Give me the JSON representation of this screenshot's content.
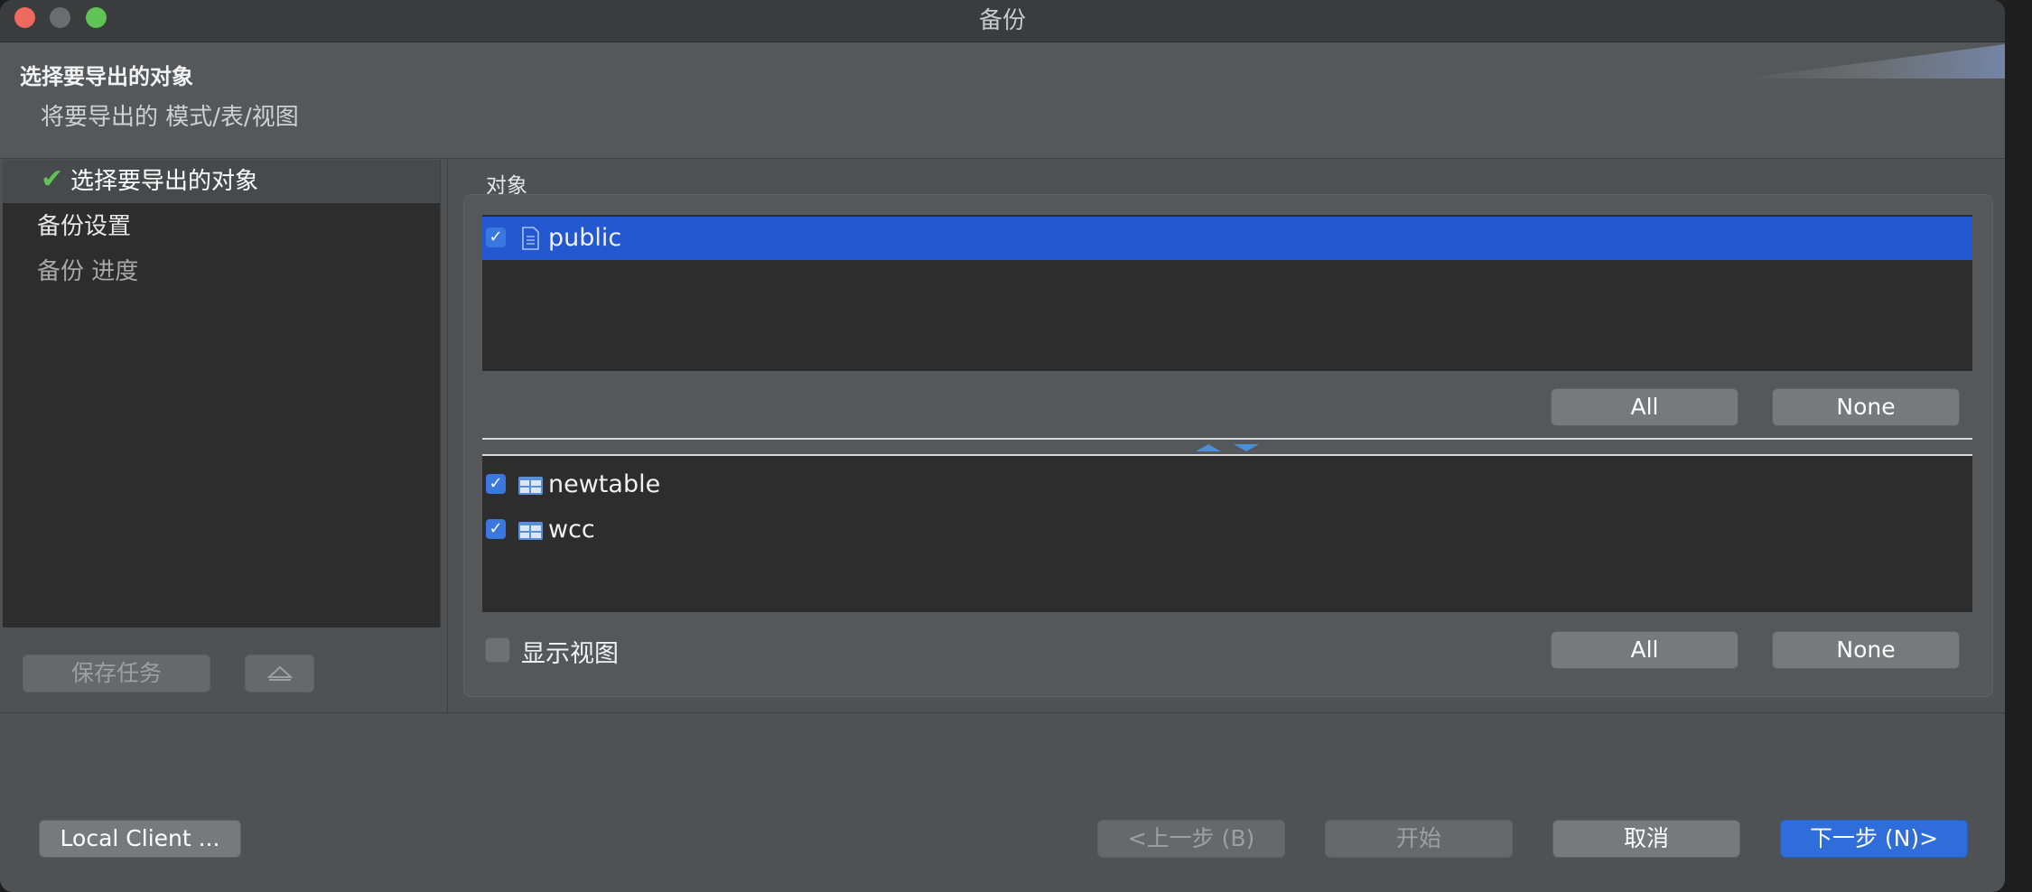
{
  "window": {
    "title": "备份"
  },
  "header": {
    "title": "选择要导出的对象",
    "subtitle": "将要导出的 模式/表/视图"
  },
  "steps": [
    {
      "label": "选择要导出的对象",
      "state": "current"
    },
    {
      "label": "备份设置",
      "state": "enabled"
    },
    {
      "label": "备份 进度",
      "state": "disabled"
    }
  ],
  "left_buttons": {
    "save_task": "保存任务",
    "move_up": "⏶"
  },
  "objects": {
    "group_title": "对象",
    "schemas": [
      {
        "label": "public",
        "checked": true,
        "selected": true
      }
    ],
    "schema_all": "All",
    "schema_none": "None",
    "tables": [
      {
        "label": "newtable",
        "checked": true
      },
      {
        "label": "wcc",
        "checked": true
      }
    ],
    "show_views_label": "显示视图",
    "show_views_checked": false,
    "table_all": "All",
    "table_none": "None"
  },
  "footer": {
    "local_client": "Local Client ...",
    "back": "<上一步 (B)",
    "start": "开始",
    "cancel": "取消",
    "next": "下一步 (N)>"
  },
  "colors": {
    "accent": "#2f6ddb",
    "selection": "#2458d1",
    "check": "#5fc454"
  }
}
